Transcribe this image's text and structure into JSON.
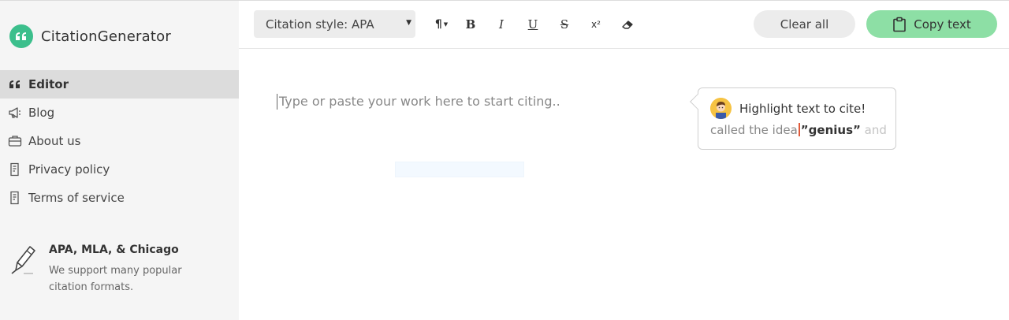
{
  "brand": {
    "name": "CitationGenerator",
    "accent": "#3cbf8c"
  },
  "sidebar": {
    "items": [
      {
        "label": "Editor",
        "icon": "quote-icon",
        "active": true
      },
      {
        "label": "Blog",
        "icon": "megaphone-icon",
        "active": false
      },
      {
        "label": "About us",
        "icon": "briefcase-icon",
        "active": false
      },
      {
        "label": "Privacy policy",
        "icon": "document-icon",
        "active": false
      },
      {
        "label": "Terms of service",
        "icon": "document-icon",
        "active": false
      }
    ],
    "promo": {
      "title": "APA, MLA, & Chicago",
      "description": "We support many popular citation formats.",
      "icon": "pen-icon"
    }
  },
  "toolbar": {
    "citation_style": "Citation style: APA",
    "format_buttons": [
      {
        "name": "paragraph",
        "icon": "paragraph-icon"
      },
      {
        "name": "bold",
        "label": "B"
      },
      {
        "name": "italic",
        "label": "I"
      },
      {
        "name": "underline",
        "label": "U"
      },
      {
        "name": "strikethrough",
        "label": "S"
      },
      {
        "name": "superscript",
        "label": "x²"
      },
      {
        "name": "clear-format",
        "icon": "eraser-icon"
      }
    ],
    "clear_label": "Clear all",
    "copy_label": "Copy text",
    "copy_color": "#8ddfa5"
  },
  "editor": {
    "placeholder": "Type or paste your work here to start citing..",
    "tooltip": {
      "title": "Highlight text to cite!",
      "example_before": "called the idea",
      "example_highlight": "”genius”",
      "example_after": "and"
    }
  }
}
